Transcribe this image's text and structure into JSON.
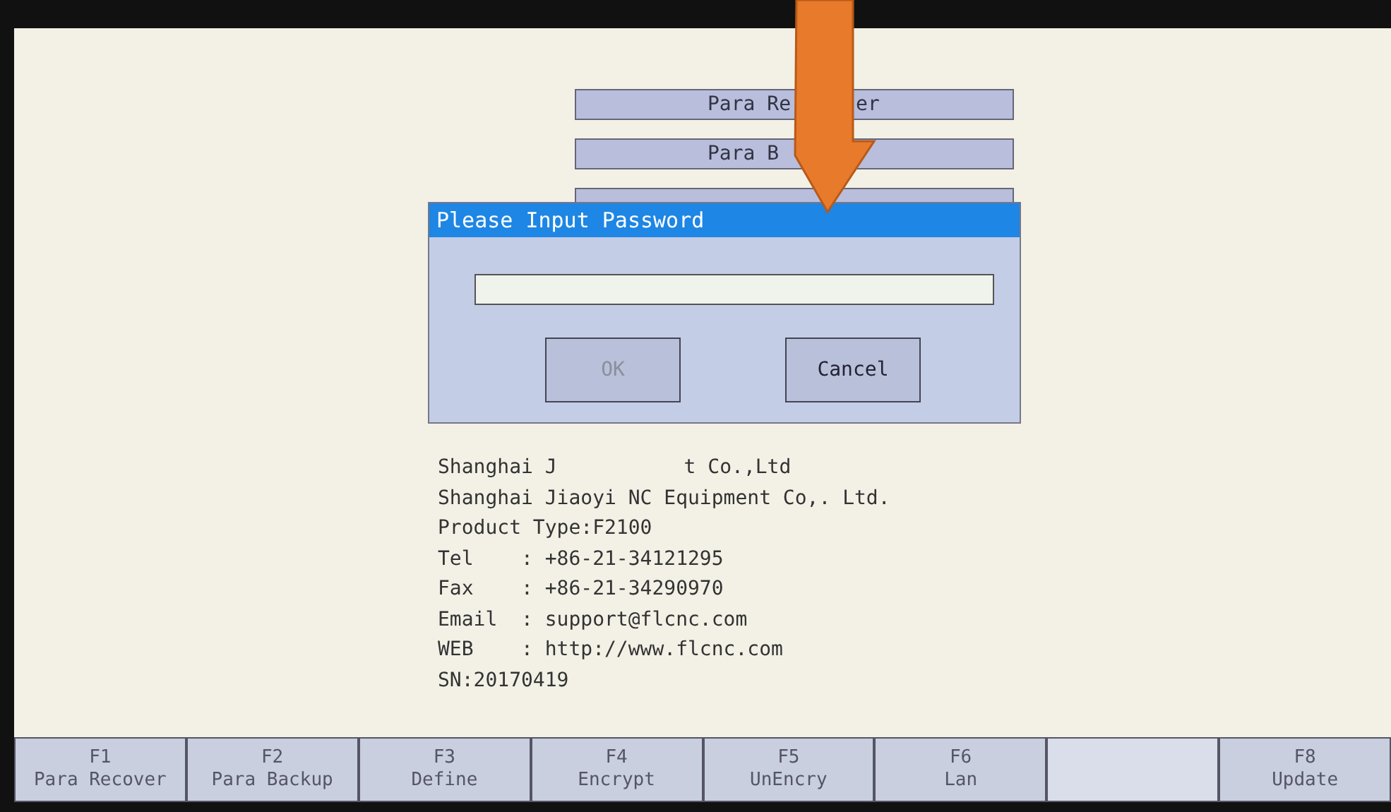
{
  "menu_buttons": [
    {
      "label_parts": [
        "Para Re",
        "er"
      ]
    },
    {
      "label_parts": [
        "Para B"
      ]
    },
    {
      "kind": "covered"
    }
  ],
  "dialog": {
    "title": "Please Input Password",
    "buttons": [
      {
        "label": "OK",
        "disabled": true
      },
      {
        "label": "Cancel",
        "disabled": false
      }
    ]
  },
  "info_lines": [
    {
      "parts": [
        "Shanghai J",
        "t Co.,Ltd"
      ]
    },
    {
      "parts": [
        "Shanghai Jiaoyi NC Equipment Co,. Ltd."
      ]
    },
    {
      "parts": [
        "Product Type:F2100"
      ]
    },
    {
      "parts": [
        "Tel    : +86-21-34121295"
      ]
    },
    {
      "parts": [
        "Fax    : +86-21-34290970"
      ]
    },
    {
      "parts": [
        "Email  : support@flcnc.com"
      ]
    },
    {
      "parts": [
        "WEB    : http://www.flcnc.com"
      ]
    },
    {
      "parts": [
        "SN:20170419"
      ]
    }
  ],
  "function_keys": [
    {
      "key": "F1",
      "label": "Para Recover"
    },
    {
      "key": "F2",
      "label": "Para Backup"
    },
    {
      "key": "F3",
      "label": "Define"
    },
    {
      "key": "F4",
      "label": "Encrypt"
    },
    {
      "key": "F5",
      "label": "UnEncry"
    },
    {
      "key": "F6",
      "label": "Lan"
    },
    {
      "kind": "blank"
    },
    {
      "key": "F8",
      "label": "Update"
    }
  ]
}
